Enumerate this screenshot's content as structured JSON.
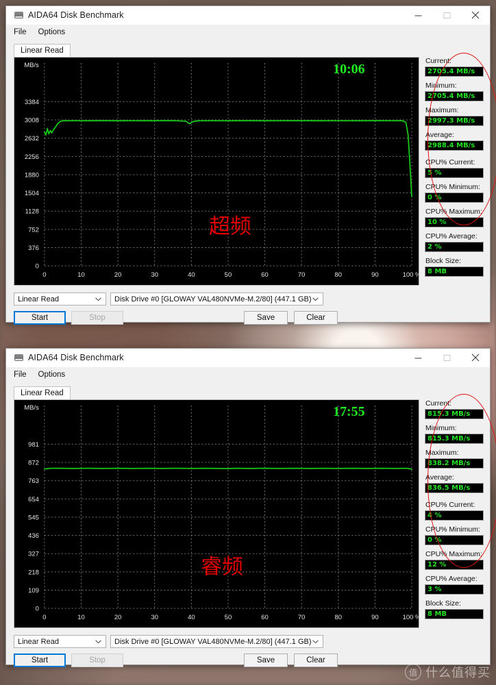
{
  "watermark": {
    "logo_char": "值",
    "text": "什么值得买"
  },
  "windows": [
    {
      "title": "AIDA64 Disk Benchmark",
      "icon": "disk-drive-icon",
      "menu": [
        "File",
        "Options"
      ],
      "tab": "Linear Read",
      "buttons": {
        "minimize": "–",
        "maximize": "□",
        "close": "✕"
      },
      "mode_select": "Linear Read",
      "drive_select": "Disk Drive #0  [GLOWAY VAL480NVMe-M.2/80]  (447.1 GB)",
      "start_label": "Start",
      "stop_label": "Stop",
      "save_label": "Save",
      "clear_label": "Clear",
      "stats": [
        {
          "label": "Current:",
          "value": "2705.4 MB/s",
          "highlight": true
        },
        {
          "label": "Minimum:",
          "value": "2705.4 MB/s",
          "highlight": true
        },
        {
          "label": "Maximum:",
          "value": "2997.3 MB/s",
          "highlight": true
        },
        {
          "label": "Average:",
          "value": "2988.4 MB/s",
          "highlight": true
        },
        {
          "label": "CPU% Current:",
          "value": "5 %",
          "highlight": false
        },
        {
          "label": "CPU% Minimum:",
          "value": "0 %",
          "highlight": false
        },
        {
          "label": "CPU% Maximum:",
          "value": "10 %",
          "highlight": false
        },
        {
          "label": "CPU% Average:",
          "value": "2 %",
          "highlight": false
        },
        {
          "label": "Block Size:",
          "value": "8 MB",
          "highlight": false
        }
      ],
      "chart_data": {
        "type": "line",
        "title": "",
        "timer": "10:06",
        "annotation": "超频",
        "annotation_color": "#e00000",
        "line_color": "#16c816",
        "grid": true,
        "background": "#000000",
        "xlabel": "",
        "ylabel": "MB/s",
        "x_unit": "%",
        "xticks": [
          0,
          10,
          20,
          30,
          40,
          50,
          60,
          70,
          80,
          90,
          100
        ],
        "xtick_labels": [
          "0",
          "10",
          "20",
          "30",
          "40",
          "50",
          "60",
          "70",
          "80",
          "90",
          "100 %"
        ],
        "yticks": [
          0,
          376,
          752,
          1128,
          1504,
          1880,
          2256,
          2632,
          3008,
          3384
        ],
        "xlim": [
          0,
          100
        ],
        "ylim": [
          0,
          3760
        ],
        "series": [
          {
            "name": "Linear Read",
            "x": [
              0.0,
              0.4,
              0.8,
              1.2,
              1.6,
              2.0,
              2.4,
              3.0,
              3.6,
              4.3,
              5.0,
              8,
              12,
              16,
              20,
              24,
              28,
              32,
              36,
              38.5,
              39.5,
              40.5,
              42,
              46,
              50,
              55,
              60,
              65,
              70,
              75,
              80,
              85,
              90,
              95,
              97.5,
              98.4,
              99.0,
              99.5,
              100
            ],
            "values": [
              2760,
              2700,
              2830,
              2720,
              2790,
              2740,
              2800,
              2860,
              2930,
              2975,
              2990,
              2991,
              2990,
              2992,
              2990,
              2991,
              2990,
              2992,
              2991,
              2980,
              2930,
              2975,
              2990,
              2991,
              2990,
              2992,
              2990,
              2991,
              2992,
              2990,
              2991,
              2990,
              2992,
              2991,
              2990,
              2960,
              2700,
              2100,
              1430
            ]
          }
        ]
      }
    },
    {
      "title": "AIDA64 Disk Benchmark",
      "icon": "disk-drive-icon",
      "menu": [
        "File",
        "Options"
      ],
      "tab": "Linear Read",
      "buttons": {
        "minimize": "–",
        "maximize": "□",
        "close": "✕"
      },
      "mode_select": "Linear Read",
      "drive_select": "Disk Drive #0  [GLOWAY VAL480NVMe-M.2/80]  (447.1 GB)",
      "start_label": "Start",
      "stop_label": "Stop",
      "save_label": "Save",
      "clear_label": "Clear",
      "stats": [
        {
          "label": "Current:",
          "value": "815.3 MB/s",
          "highlight": true
        },
        {
          "label": "Minimum:",
          "value": "815.3 MB/s",
          "highlight": true
        },
        {
          "label": "Maximum:",
          "value": "838.2 MB/s",
          "highlight": true
        },
        {
          "label": "Average:",
          "value": "836.5 MB/s",
          "highlight": true
        },
        {
          "label": "CPU% Current:",
          "value": "4 %",
          "highlight": false
        },
        {
          "label": "CPU% Minimum:",
          "value": "0 %",
          "highlight": false
        },
        {
          "label": "CPU% Maximum:",
          "value": "12 %",
          "highlight": false
        },
        {
          "label": "CPU% Average:",
          "value": "3 %",
          "highlight": false
        },
        {
          "label": "Block Size:",
          "value": "8 MB",
          "highlight": false
        }
      ],
      "chart_data": {
        "type": "line",
        "title": "",
        "timer": "17:55",
        "annotation": "睿频",
        "annotation_color": "#e00000",
        "line_color": "#16c816",
        "grid": true,
        "background": "#000000",
        "xlabel": "",
        "ylabel": "MB/s",
        "x_unit": "%",
        "xticks": [
          0,
          10,
          20,
          30,
          40,
          50,
          60,
          70,
          80,
          90,
          100
        ],
        "xtick_labels": [
          "0",
          "10",
          "20",
          "30",
          "40",
          "50",
          "60",
          "70",
          "80",
          "90",
          "100 %"
        ],
        "yticks": [
          0,
          109,
          218,
          327,
          436,
          545,
          654,
          763,
          872,
          981
        ],
        "xlim": [
          0,
          100
        ],
        "ylim": [
          0,
          1090
        ],
        "series": [
          {
            "name": "Linear Read",
            "x": [
              0,
              1,
              2,
              4,
              8,
              12,
              16,
              20,
              24,
              28,
              32,
              36,
              40,
              44,
              48,
              50,
              52,
              56,
              60,
              64,
              68,
              72,
              76,
              80,
              84,
              88,
              92,
              96,
              98,
              99,
              99.6,
              100
            ],
            "values": [
              832,
              836,
              837,
              837,
              836,
              837,
              836,
              837,
              836,
              837,
              836,
              837,
              836,
              837,
              836,
              835,
              837,
              836,
              837,
              836,
              837,
              836,
              837,
              836,
              837,
              836,
              837,
              836,
              837,
              836,
              834,
              830
            ]
          }
        ]
      }
    }
  ]
}
